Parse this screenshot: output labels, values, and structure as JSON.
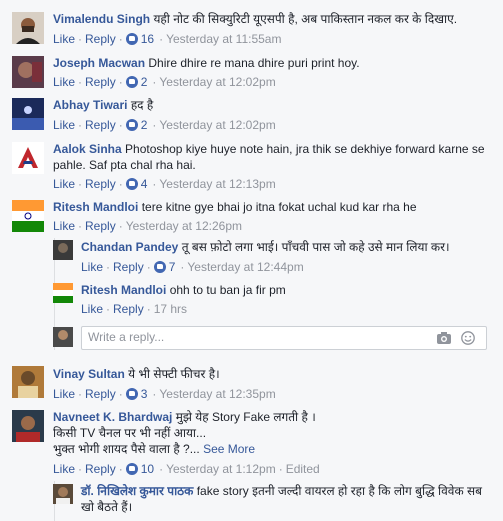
{
  "actions": {
    "like": "Like",
    "reply": "Reply"
  },
  "comments": [
    {
      "name": "Vimalendu Singh",
      "text": "यही नोट की सिक्युरिटी यूएसपी है, अब पाकिस्तान नकल कर के दिखाए.",
      "likes": "16",
      "time": "Yesterday at 11:55am"
    },
    {
      "name": "Joseph Macwan",
      "text": "Dhire dhire re mana dhire puri print hoy.",
      "likes": "2",
      "time": "Yesterday at 12:02pm"
    },
    {
      "name": "Abhay Tiwari",
      "text": "हद है",
      "likes": "2",
      "time": "Yesterday at 12:02pm"
    },
    {
      "name": "Aalok Sinha",
      "text": "Photoshop kiye huye note hain, jra thik se dekhiye forward karne se pahle. Saf pta chal rha hai.",
      "likes": "4",
      "time": "Yesterday at 12:13pm"
    },
    {
      "name": "Ritesh Mandloi",
      "text": "tere kitne gye bhai jo itna fokat uchal kud kar rha he",
      "time": "Yesterday at 12:26pm"
    },
    {
      "name": "Vinay Sultan",
      "text": "ये भी सेफ्टी फीचर है।",
      "likes": "3",
      "time": "Yesterday at 12:35pm"
    },
    {
      "name": "Navneet K. Bhardwaj",
      "text_line1": "मुझे येह Story Fake लगती है ।",
      "text_line2": "किसी TV चैनल पर भी नहीं आया...",
      "text_line3": "भुक्त भोगी शायद पैसे वाला है ?...",
      "see_more": "See More",
      "likes": "10",
      "time": "Yesterday at 1:12pm",
      "edited": "Edited"
    }
  ],
  "replies": [
    {
      "name": "Chandan Pandey",
      "text": "तू बस फ़ोटो लगा भाई। पाँचवी पास जो कहे उसे मान लिया कर।",
      "likes": "7",
      "time": "Yesterday at 12:44pm"
    },
    {
      "name": "Ritesh Mandloi",
      "text": "ohh to tu ban ja fir pm",
      "time": "17 hrs"
    },
    {
      "name": "डॉ. निखिलेश कुमार पाठक",
      "text": "fake story इतनी जल्दी वायरल हो रहा है कि लोग बुद्धि विवेक सब खो बैठते हैं।"
    }
  ],
  "reply_box": {
    "placeholder": "Write a reply..."
  },
  "icons": {
    "camera": "camera-icon",
    "emoji": "emoji-icon",
    "like": "like-icon"
  },
  "colors": {
    "link": "#365899",
    "meta": "#90949c",
    "like_badge": "#4267b2",
    "background": "#f6f7f9"
  }
}
